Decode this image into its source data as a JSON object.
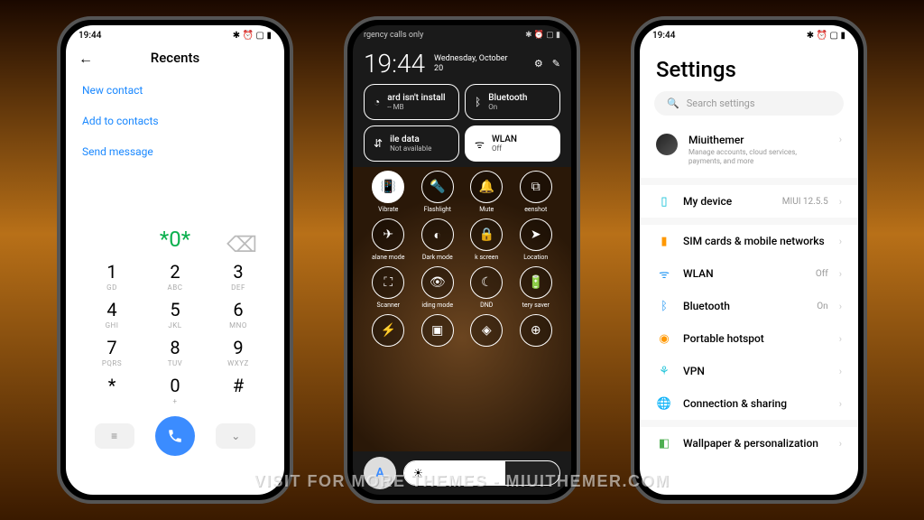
{
  "status": {
    "time": "19:44",
    "icons": "✱ ⏰ ▢ ▮"
  },
  "phone1": {
    "header": "Recents",
    "options": [
      "New contact",
      "Add to contacts",
      "Send message"
    ],
    "input": "*0*",
    "keys": [
      {
        "n": "1",
        "l": "GD"
      },
      {
        "n": "2",
        "l": "ABC"
      },
      {
        "n": "3",
        "l": "DEF"
      },
      {
        "n": "4",
        "l": "GHI"
      },
      {
        "n": "5",
        "l": "JKL"
      },
      {
        "n": "6",
        "l": "MNO"
      },
      {
        "n": "7",
        "l": "PQRS"
      },
      {
        "n": "8",
        "l": "TUV"
      },
      {
        "n": "9",
        "l": "WXYZ"
      },
      {
        "n": "*",
        "l": ""
      },
      {
        "n": "0",
        "l": "+"
      },
      {
        "n": "#",
        "l": ""
      }
    ]
  },
  "phone2": {
    "carrier": "rgency calls only",
    "clock": "19:44",
    "date_line1": "Wednesday, October",
    "date_line2": "20",
    "big_tiles": [
      {
        "title": "ard isn't install",
        "sub": "-- MB",
        "icon": "◔",
        "active": false
      },
      {
        "title": "Bluetooth",
        "sub": "On",
        "icon": "ᛒ",
        "active": false
      },
      {
        "title": "ile data",
        "sub": "Not available",
        "icon": "⇵",
        "active": false
      },
      {
        "title": "WLAN",
        "sub": "Off",
        "icon": "ᯤ",
        "active": true
      }
    ],
    "small_tiles": [
      {
        "lbl": "Vibrate",
        "icon": "📳",
        "active": true
      },
      {
        "lbl": "Flashlight",
        "icon": "🔦",
        "active": false
      },
      {
        "lbl": "Mute",
        "icon": "🔔",
        "active": false
      },
      {
        "lbl": "eenshot",
        "icon": "⧉",
        "active": false
      },
      {
        "lbl": "alane mode",
        "icon": "✈",
        "active": false
      },
      {
        "lbl": "Dark mode",
        "icon": "◐",
        "active": false
      },
      {
        "lbl": "k screen",
        "icon": "🔒",
        "active": false
      },
      {
        "lbl": "Location",
        "icon": "➤",
        "active": false
      },
      {
        "lbl": "Scanner",
        "icon": "⛶",
        "active": false
      },
      {
        "lbl": "iding mode",
        "icon": "👁",
        "active": false
      },
      {
        "lbl": "DND",
        "icon": "☾",
        "active": false
      },
      {
        "lbl": "tery saver",
        "icon": "🔋",
        "active": false
      },
      {
        "lbl": "",
        "icon": "⚡",
        "active": false
      },
      {
        "lbl": "",
        "icon": "▣",
        "active": false
      },
      {
        "lbl": "",
        "icon": "◈",
        "active": false
      },
      {
        "lbl": "",
        "icon": "⊕",
        "active": false
      }
    ],
    "auto": "A"
  },
  "phone3": {
    "title": "Settings",
    "search_placeholder": "Search settings",
    "profile": {
      "name": "Miuithemer",
      "sub": "Manage accounts, cloud services, payments, and more"
    },
    "device": {
      "label": "My device",
      "value": "MIUI 12.5.5"
    },
    "items": [
      {
        "label": "SIM cards & mobile networks",
        "icon": "▮",
        "cls": "c-orange",
        "value": ""
      },
      {
        "label": "WLAN",
        "icon": "ᯤ",
        "cls": "c-blue",
        "value": "Off"
      },
      {
        "label": "Bluetooth",
        "icon": "ᛒ",
        "cls": "c-blue",
        "value": "On"
      },
      {
        "label": "Portable hotspot",
        "icon": "◉",
        "cls": "c-orange",
        "value": ""
      },
      {
        "label": "VPN",
        "icon": "⚘",
        "cls": "c-cyan",
        "value": ""
      },
      {
        "label": "Connection & sharing",
        "icon": "🌐",
        "cls": "c-blue",
        "value": ""
      }
    ],
    "wallpaper": {
      "label": "Wallpaper & personalization",
      "icon": "◧",
      "cls": "c-green"
    }
  },
  "watermark": "VISIT FOR MORE THEMES - MIUITHEMER.COM"
}
